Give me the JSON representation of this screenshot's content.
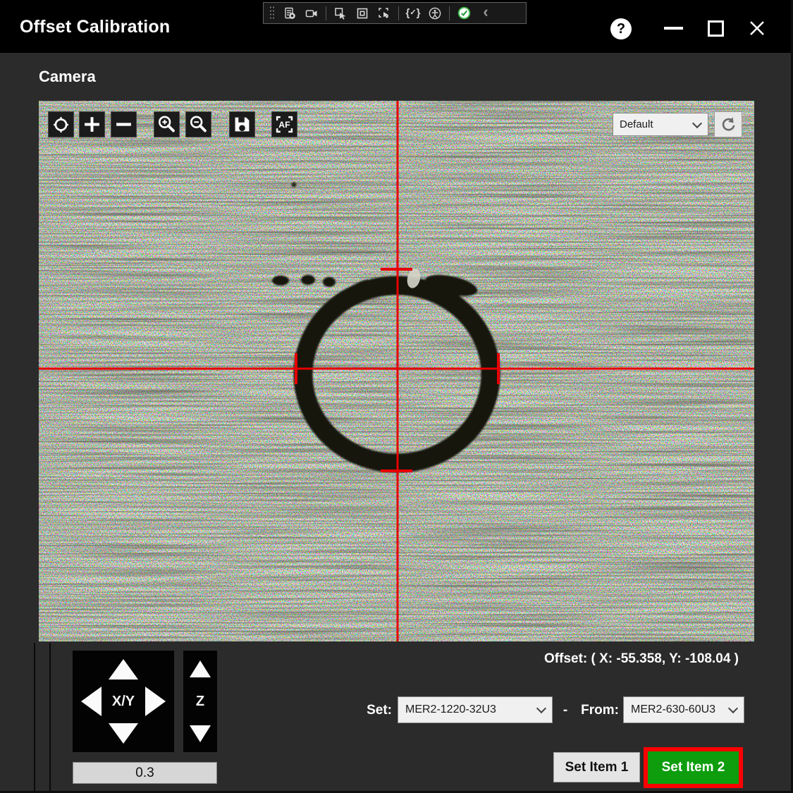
{
  "window": {
    "title": "Offset Calibration",
    "titlebar": {
      "help_glyph": "?",
      "collapse_glyph": "‹",
      "hot_reload": {
        "open": "{",
        "check": "✓",
        "close": "}"
      },
      "toolbar_icons": [
        "grip-handle",
        "live-visual-tree",
        "screen-record",
        "select-element",
        "display-layout-adorners",
        "track-focused-element",
        "hot-reload",
        "accessibility-checker",
        "status-check",
        "collapse-chevron"
      ],
      "window_controls": [
        "help",
        "minimize",
        "maximize",
        "close"
      ]
    }
  },
  "camera": {
    "section_label": "Camera",
    "toolbar": {
      "icons": [
        "reticle",
        "increase",
        "decrease",
        "zoom-in",
        "zoom-out",
        "save-image",
        "autofocus"
      ],
      "af_label": "AF"
    },
    "profile_dropdown": {
      "value": "Default"
    },
    "refresh_icon": "refresh",
    "overlay": {
      "crosshair_color": "#e60000"
    }
  },
  "jog": {
    "xy_label": "X/Y",
    "z_label": "Z",
    "step_value": "0.3"
  },
  "offset": {
    "label": "Offset: ( X: -55.358, Y: -108.04 )",
    "x": "-55.358",
    "y": "-108.04"
  },
  "mapping": {
    "set_label": "Set:",
    "set_value": "MER2-1220-32U3",
    "separator": "-",
    "from_label": "From:",
    "from_value": "MER2-630-60U3"
  },
  "actions": {
    "set_item_1": "Set Item 1",
    "set_item_2": "Set Item 2",
    "highlight_color": "#ff0000",
    "set_item_2_bg": "#0d9d0d"
  }
}
